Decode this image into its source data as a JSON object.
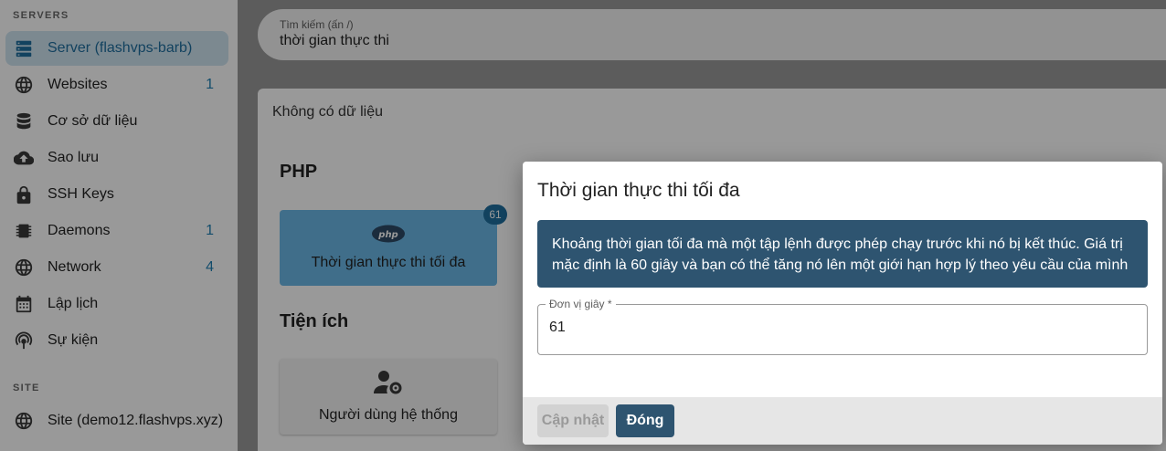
{
  "sidebar": {
    "servers_label": "SERVERS",
    "site_label": "SITE",
    "items": [
      {
        "label": "Server (flashvps-barb)",
        "icon": "server-icon",
        "count": ""
      },
      {
        "label": "Websites",
        "icon": "globe-icon",
        "count": "1"
      },
      {
        "label": "Cơ sở dữ liệu",
        "icon": "database-icon",
        "count": ""
      },
      {
        "label": "Sao lưu",
        "icon": "cloud-upload-icon",
        "count": ""
      },
      {
        "label": "SSH Keys",
        "icon": "lock-icon",
        "count": ""
      },
      {
        "label": "Daemons",
        "icon": "chip-icon",
        "count": "1"
      },
      {
        "label": "Network",
        "icon": "globe-icon",
        "count": "4"
      },
      {
        "label": "Lập lịch",
        "icon": "calendar-icon",
        "count": ""
      },
      {
        "label": "Sự kiện",
        "icon": "broadcast-icon",
        "count": ""
      }
    ],
    "site_items": [
      {
        "label": "Site (demo12.flashvps.xyz)",
        "icon": "globe-icon"
      }
    ]
  },
  "search": {
    "label": "Tìm kiếm (ấn /)",
    "value": "thời gian thực thi"
  },
  "main": {
    "no_data": "Không có dữ liệu",
    "php_title": "PHP",
    "php_tile": {
      "label": "Thời gian thực thi tối đa",
      "badge": "61",
      "icon": "php-icon"
    },
    "util_title": "Tiện ích",
    "util_tile": {
      "label": "Người dùng hệ thống",
      "icon": "user-gear-icon"
    }
  },
  "dialog": {
    "title": "Thời gian thực thi tối đa",
    "info_line1": "Khoảng thời gian tối đa mà một tập lệnh được phép chạy trước khi nó bị kết thúc. Giá trị",
    "info_line2": "mặc định là 60 giây và bạn có thể tăng nó lên một giới hạn hợp lý theo yêu cầu của mình",
    "field_label": "Đơn vị giây *",
    "field_value": "61",
    "update_label": "Cập nhật",
    "close_label": "Đóng"
  },
  "colors": {
    "accent": "#1f6e9e",
    "dialog_dark": "#2e5470",
    "tile_php": "#6bb8e6"
  }
}
